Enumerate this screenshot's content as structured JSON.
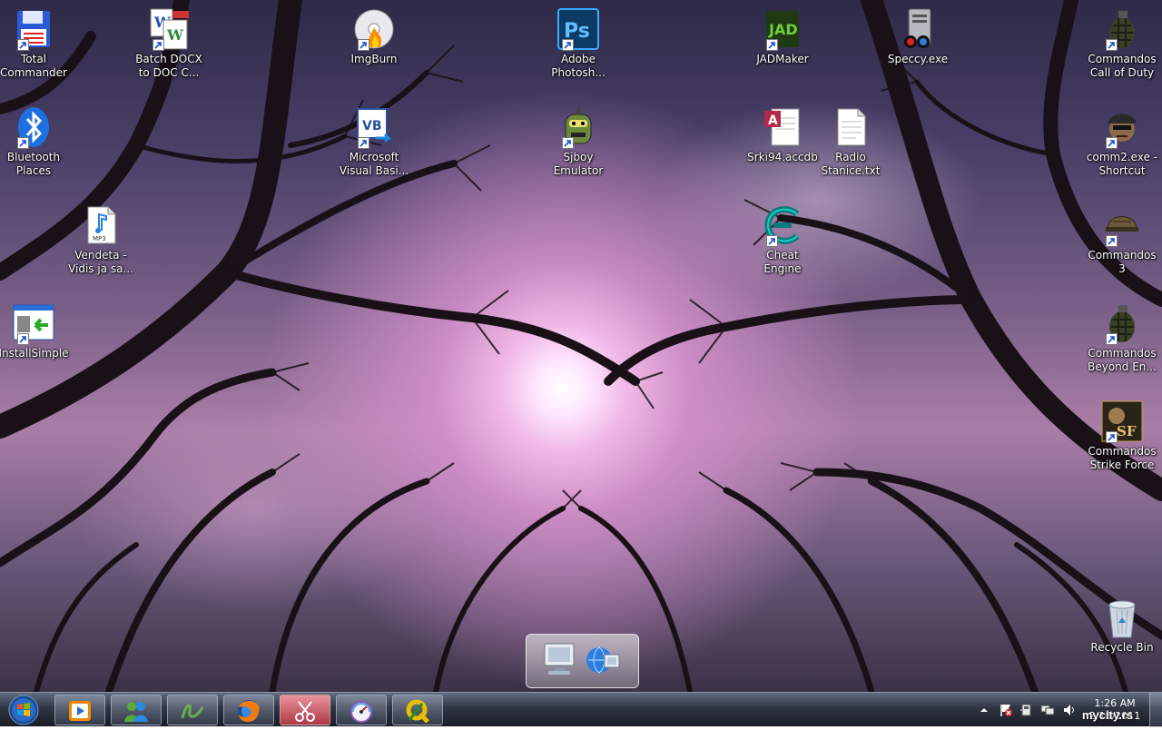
{
  "desktop_icons": [
    {
      "label": "Total\nCommander",
      "icon": "floppy-disk-icon"
    },
    {
      "label": "Batch DOCX\nto DOC C...",
      "icon": "word-docs-icon"
    },
    {
      "label": "ImgBurn",
      "icon": "disc-burn-icon"
    },
    {
      "label": "Adobe\nPhotosh...",
      "icon": "photoshop-icon"
    },
    {
      "label": "JADMaker",
      "icon": "jadmaker-icon"
    },
    {
      "label": "Speccy.exe",
      "icon": "speccy-icon"
    },
    {
      "label": "Commandos\nCall of Duty",
      "icon": "grenade-icon"
    },
    {
      "label": "Bluetooth\nPlaces",
      "icon": "bluetooth-icon"
    },
    {
      "label": "Microsoft\nVisual Basi...",
      "icon": "visual-basic-icon"
    },
    {
      "label": "Sjboy\nEmulator",
      "icon": "robot-head-icon"
    },
    {
      "label": "Srki94.accdb",
      "icon": "access-database-icon"
    },
    {
      "label": "Radio\nStanice.txt",
      "icon": "text-file-icon"
    },
    {
      "label": "comm2.exe -\nShortcut",
      "icon": "soldier-icon"
    },
    {
      "label": "Vendeta -\nVidis ja sa...",
      "icon": "mp3-file-icon"
    },
    {
      "label": "Cheat Engine",
      "icon": "cheat-engine-icon"
    },
    {
      "label": "Commandos\n3",
      "icon": "helmet-icon"
    },
    {
      "label": "InstallSimple",
      "icon": "installer-icon"
    },
    {
      "label": "Commandos\nBeyond En...",
      "icon": "grenade-icon"
    },
    {
      "label": "Commandos\nStrike Force",
      "icon": "strike-force-icon"
    },
    {
      "label": "Recycle Bin",
      "icon": "recycle-bin-icon"
    }
  ],
  "dock": [
    {
      "icon": "computer-monitor-icon"
    },
    {
      "icon": "network-globe-icon"
    }
  ],
  "taskbar": {
    "start": "windows-orb-icon",
    "buttons": [
      {
        "icon": "media-player-icon"
      },
      {
        "icon": "messenger-icon"
      },
      {
        "icon": "calligraphy-app-icon"
      },
      {
        "icon": "firefox-icon"
      },
      {
        "icon": "snipping-tool-icon",
        "active": true
      },
      {
        "icon": "speedometer-icon"
      },
      {
        "icon": "q-app-icon"
      }
    ],
    "tray_icons": [
      "show-hidden-icons-chevron",
      "action-center-flag-icon",
      "usb-device-icon",
      "network-icon",
      "volume-icon"
    ]
  },
  "clock": {
    "time": "1:26 AM",
    "date": "2/15/2011"
  },
  "watermark": "mycity.rs",
  "colors": {
    "label_text": "#ffffff",
    "taskbar": "#1e2330",
    "sky_glow": "#ffe8ff"
  }
}
